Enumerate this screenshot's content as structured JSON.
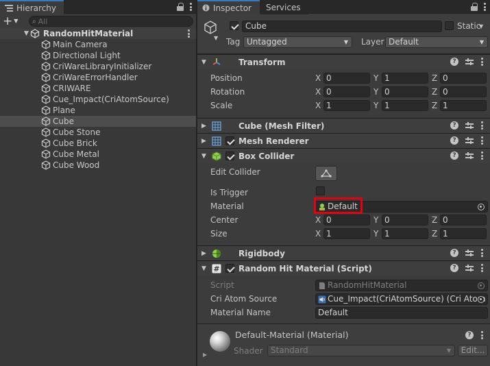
{
  "hierarchy": {
    "tab_label": "Hierarchy",
    "search_placeholder": "All",
    "scene_name": "RandomHitMaterial",
    "items": [
      {
        "label": "Main Camera"
      },
      {
        "label": "Directional Light"
      },
      {
        "label": "CriWareLibraryInitializer"
      },
      {
        "label": "CriWareErrorHandler"
      },
      {
        "label": "CRIWARE"
      },
      {
        "label": "Cue_Impact(CriAtomSource)"
      },
      {
        "label": "Plane"
      },
      {
        "label": "Cube",
        "selected": true
      },
      {
        "label": "Cube Stone"
      },
      {
        "label": "Cube Brick"
      },
      {
        "label": "Cube Metal"
      },
      {
        "label": "Cube Wood"
      }
    ]
  },
  "inspector": {
    "tabs": [
      {
        "label": "Inspector",
        "active": true
      },
      {
        "label": "Services",
        "active": false
      }
    ],
    "object": {
      "name": "Cube",
      "static_label": "Static",
      "tag_label": "Tag",
      "tag_value": "Untagged",
      "layer_label": "Layer",
      "layer_value": "Default"
    },
    "transform": {
      "title": "Transform",
      "rows": [
        {
          "label": "Position",
          "x": "0",
          "y": "1",
          "z": "0"
        },
        {
          "label": "Rotation",
          "x": "0",
          "y": "0",
          "z": "0"
        },
        {
          "label": "Scale",
          "x": "1",
          "y": "1",
          "z": "1"
        }
      ]
    },
    "axis_labels": {
      "x": "X",
      "y": "Y",
      "z": "Z"
    },
    "mesh_filter": {
      "title": "Cube (Mesh Filter)"
    },
    "mesh_renderer": {
      "title": "Mesh Renderer"
    },
    "box_collider": {
      "title": "Box Collider",
      "edit_collider_label": "Edit Collider",
      "is_trigger_label": "Is Trigger",
      "material_label": "Material",
      "material_value": "Default",
      "center": {
        "label": "Center",
        "x": "0",
        "y": "0",
        "z": "0"
      },
      "size": {
        "label": "Size",
        "x": "1",
        "y": "1",
        "z": "1"
      }
    },
    "rigidbody": {
      "title": "Rigidbody"
    },
    "script": {
      "title": "Random Hit Material (Script)",
      "script_label": "Script",
      "script_value": "RandomHitMaterial",
      "cri_label": "Cri Atom Source",
      "cri_value": "Cue_Impact(CriAtomSource) (Cri Atom",
      "matname_label": "Material Name",
      "matname_value": "Default"
    },
    "material": {
      "title": "Default-Material (Material)",
      "shader_label": "Shader",
      "shader_value": "Standard",
      "edit_label": "Edit..."
    }
  },
  "colors": {
    "highlight": "#e8000e",
    "tab_accent": "#3a79bb"
  }
}
